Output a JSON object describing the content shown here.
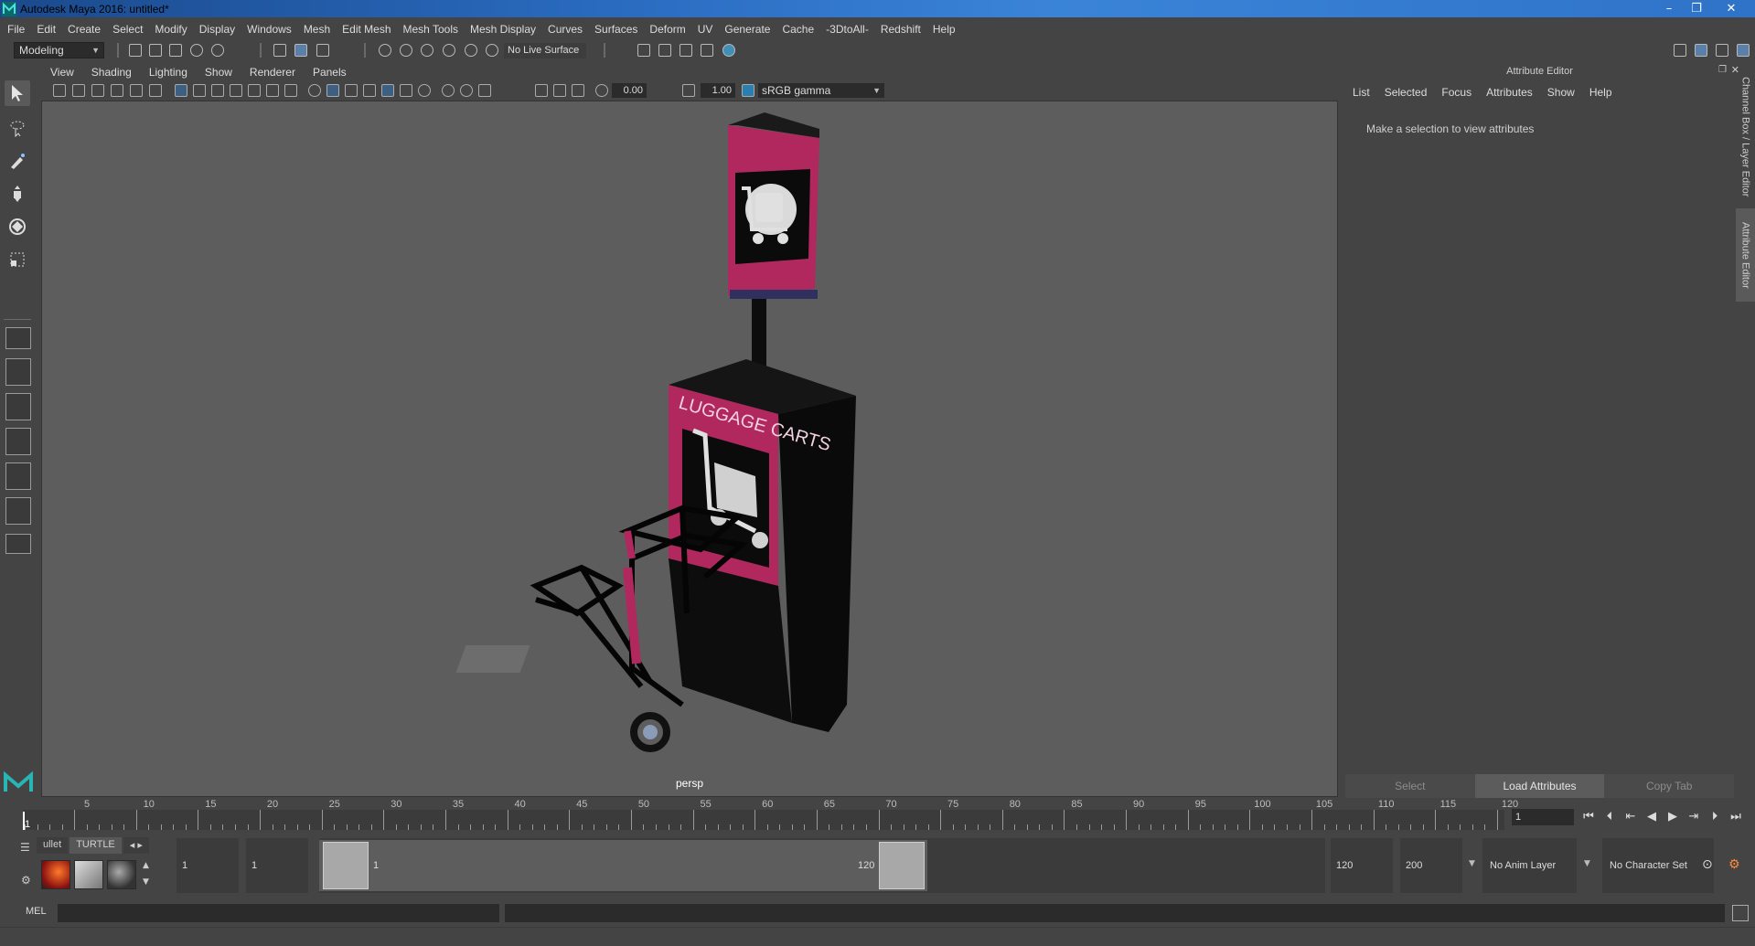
{
  "window": {
    "title": "Autodesk Maya 2016: untitled*",
    "minimize": "–",
    "maximize": "❐",
    "close": "✕"
  },
  "menubar": [
    "File",
    "Edit",
    "Create",
    "Select",
    "Modify",
    "Display",
    "Windows",
    "Mesh",
    "Edit Mesh",
    "Mesh Tools",
    "Mesh Display",
    "Curves",
    "Surfaces",
    "Deform",
    "UV",
    "Generate",
    "Cache",
    "-3DtoAll-",
    "Redshift",
    "Help"
  ],
  "statusline": {
    "mode": "Modeling",
    "live_surface": "No Live Surface"
  },
  "viewport": {
    "menu": [
      "View",
      "Shading",
      "Lighting",
      "Show",
      "Renderer",
      "Panels"
    ],
    "exposure": "0.00",
    "gamma": "1.00",
    "colorspace": "sRGB gamma",
    "camera": "persp",
    "scene_text": "LUGGAGE CARTS",
    "accent_color": "#b0285e"
  },
  "attribute_editor": {
    "title": "Attribute Editor",
    "menu": [
      "List",
      "Selected",
      "Focus",
      "Attributes",
      "Show",
      "Help"
    ],
    "message": "Make a selection to view attributes",
    "buttons": {
      "select": "Select",
      "load": "Load Attributes",
      "copy": "Copy Tab"
    },
    "side_tabs": {
      "channel_box": "Channel Box / Layer Editor",
      "attribute_editor": "Attribute Editor"
    }
  },
  "timeline": {
    "ticks": [
      "5",
      "10",
      "15",
      "20",
      "25",
      "30",
      "35",
      "40",
      "45",
      "50",
      "55",
      "60",
      "65",
      "70",
      "75",
      "80",
      "85",
      "90",
      "95",
      "100",
      "105",
      "110",
      "115",
      "120"
    ],
    "current_frame_label": "1",
    "current_frame": "1"
  },
  "shelf": {
    "tabs": [
      "ullet",
      "TURTLE"
    ]
  },
  "range": {
    "start": "1",
    "playback_start": "1",
    "range_start_label": "1",
    "range_end_label": "120",
    "playback_end": "120",
    "end": "200",
    "anim_layer": "No Anim Layer",
    "character_set": "No Character Set"
  },
  "commandline": {
    "language": "MEL"
  }
}
